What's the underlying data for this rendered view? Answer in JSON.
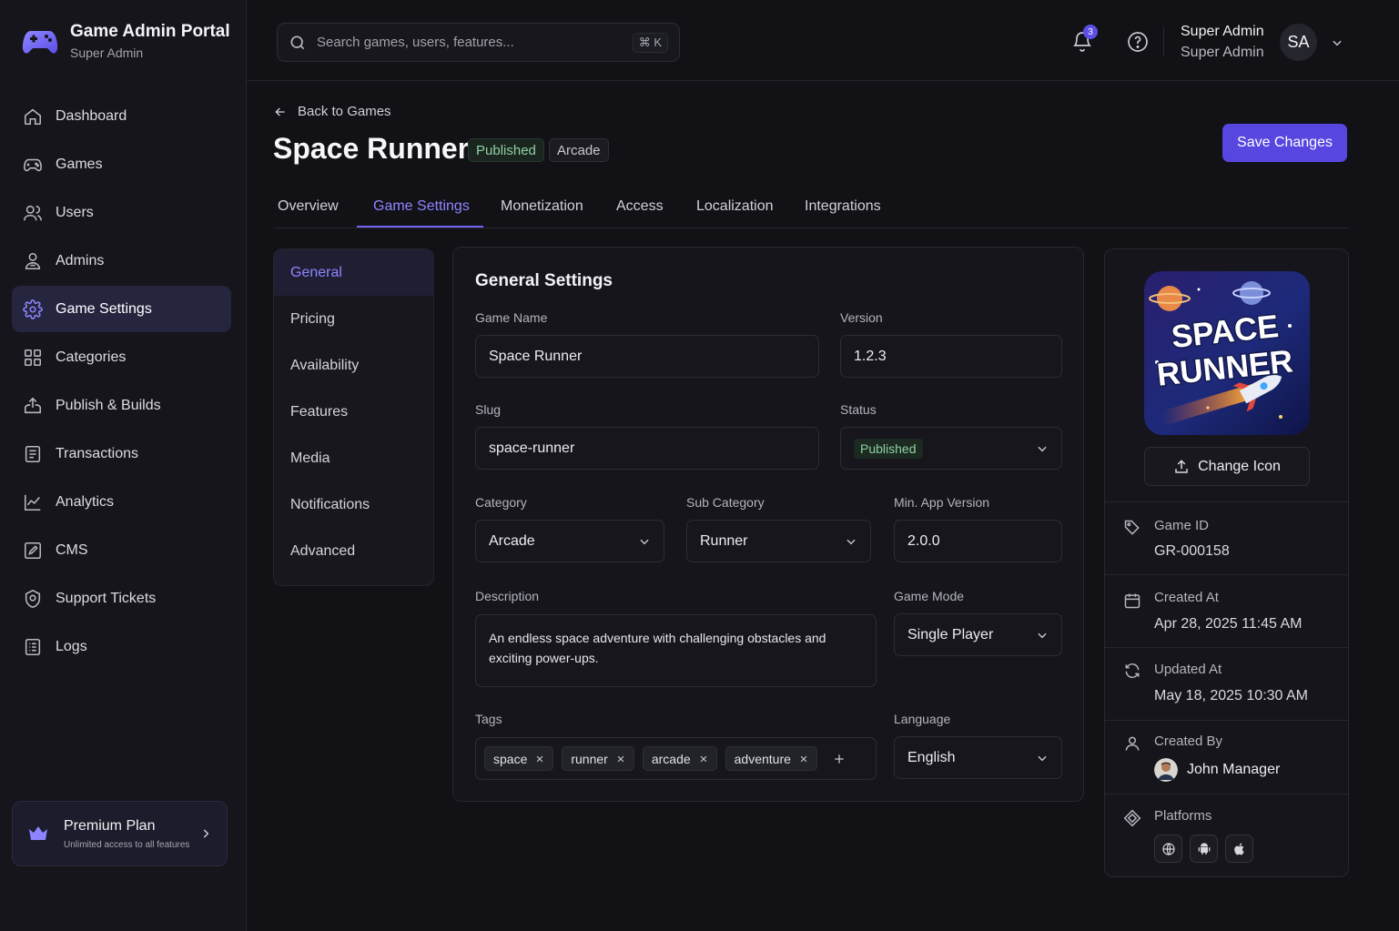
{
  "app": {
    "title": "Game Admin Portal",
    "subtitle": "Super Admin"
  },
  "sidebar": {
    "items": [
      {
        "label": "Dashboard",
        "icon": "home-icon"
      },
      {
        "label": "Games",
        "icon": "gamepad-icon"
      },
      {
        "label": "Users",
        "icon": "users-icon"
      },
      {
        "label": "Admins",
        "icon": "admins-icon"
      },
      {
        "label": "Game Settings",
        "icon": "gear-icon",
        "active": true
      },
      {
        "label": "Categories",
        "icon": "grid-icon"
      },
      {
        "label": "Publish & Builds",
        "icon": "upload-box-icon"
      },
      {
        "label": "Transactions",
        "icon": "receipt-icon"
      },
      {
        "label": "Analytics",
        "icon": "chart-line-icon"
      },
      {
        "label": "CMS",
        "icon": "pen-box-icon"
      },
      {
        "label": "Support Tickets",
        "icon": "support-icon"
      },
      {
        "label": "Logs",
        "icon": "log-file-icon"
      }
    ],
    "premium": {
      "title": "Premium Plan",
      "subtitle": "Unlimited access to all features"
    }
  },
  "header": {
    "search": {
      "placeholder": "Search games, users, features...",
      "shortcut": "⌘ K"
    },
    "notifications_count": "3",
    "user": {
      "name": "Super Admin",
      "role": "Super Admin",
      "initials": "SA"
    }
  },
  "page": {
    "back_label": "Back to Games",
    "title": "Space Runner",
    "status_badge": "Published",
    "category_badge": "Arcade",
    "save_label": "Save Changes"
  },
  "tabs": [
    {
      "label": "Overview"
    },
    {
      "label": "Game Settings",
      "active": true
    },
    {
      "label": "Monetization"
    },
    {
      "label": "Access"
    },
    {
      "label": "Localization"
    },
    {
      "label": "Integrations"
    }
  ],
  "subnav": [
    {
      "label": "General",
      "active": true
    },
    {
      "label": "Pricing"
    },
    {
      "label": "Availability"
    },
    {
      "label": "Features"
    },
    {
      "label": "Media"
    },
    {
      "label": "Notifications"
    },
    {
      "label": "Advanced"
    }
  ],
  "form": {
    "title": "General Settings",
    "game_name": {
      "label": "Game Name",
      "value": "Space Runner"
    },
    "version": {
      "label": "Version",
      "value": "1.2.3"
    },
    "slug": {
      "label": "Slug",
      "value": "space-runner"
    },
    "status": {
      "label": "Status",
      "value": "Published"
    },
    "category": {
      "label": "Category",
      "value": "Arcade"
    },
    "sub_category": {
      "label": "Sub Category",
      "value": "Runner"
    },
    "min_app_version": {
      "label": "Min. App Version",
      "value": "2.0.0"
    },
    "description": {
      "label": "Description",
      "value": "An endless space adventure with challenging obstacles and exciting power-ups."
    },
    "game_mode": {
      "label": "Game Mode",
      "value": "Single Player"
    },
    "tags": {
      "label": "Tags",
      "values": [
        "space",
        "runner",
        "arcade",
        "adventure"
      ]
    },
    "language": {
      "label": "Language",
      "value": "English"
    }
  },
  "info": {
    "icon_text": "SPACE RUNNER",
    "change_icon_label": "Change Icon",
    "game_id": {
      "label": "Game ID",
      "value": "GR-000158"
    },
    "created_at": {
      "label": "Created At",
      "value": "Apr 28, 2025 11:45 AM"
    },
    "updated_at": {
      "label": "Updated At",
      "value": "May 18, 2025 10:30 AM"
    },
    "created_by": {
      "label": "Created By",
      "value": "John Manager"
    },
    "platforms": {
      "label": "Platforms",
      "items": [
        "web-globe-icon",
        "android-icon",
        "apple-icon"
      ]
    }
  },
  "colors": {
    "accent": "#5746e0",
    "accent_text": "#8e86ff",
    "success": "#8fd0a4",
    "background": "#111116"
  }
}
